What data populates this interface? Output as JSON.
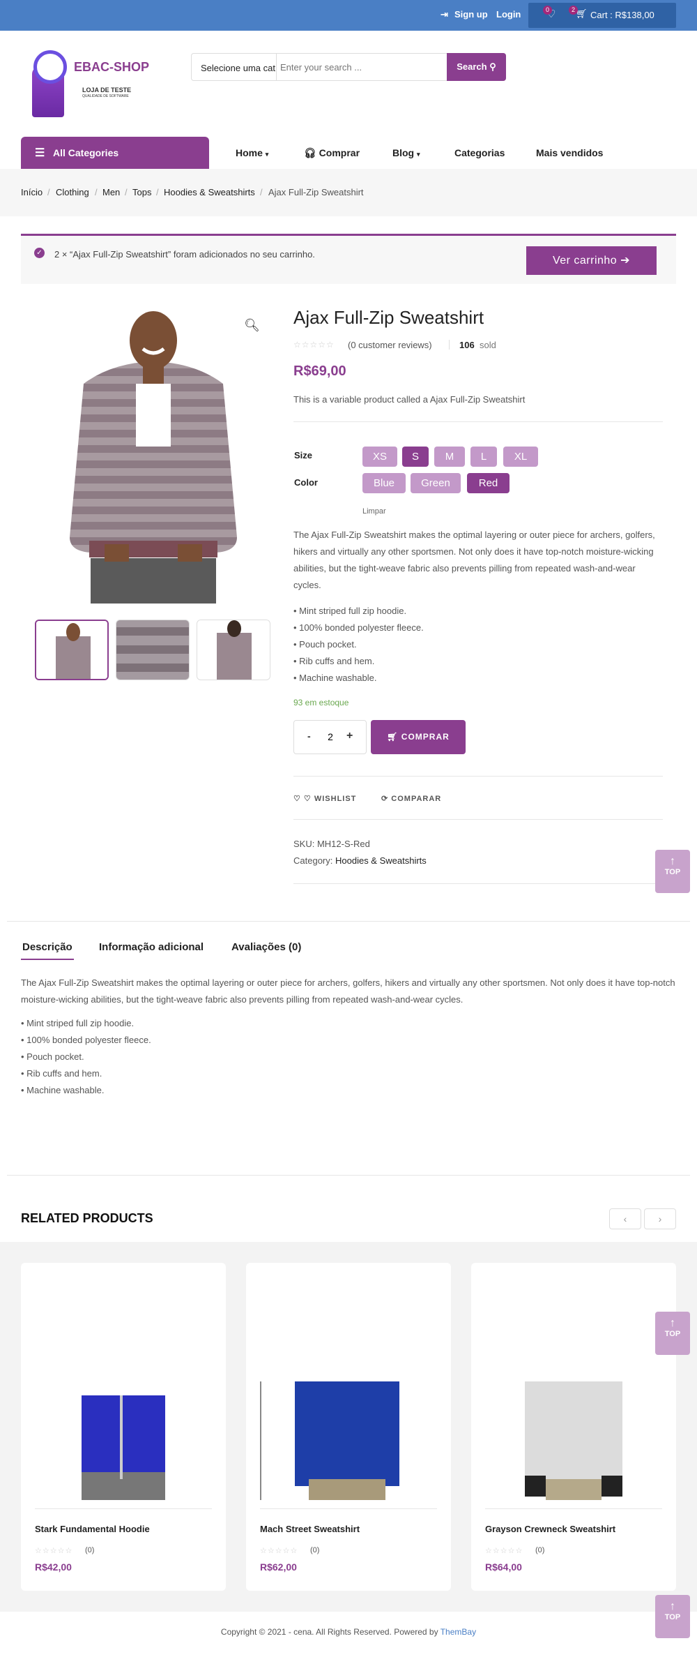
{
  "topbar": {
    "signup": "Sign up",
    "login": "Login",
    "wishlist_count": "0",
    "cart_count": "2",
    "cart_label": "Cart : R$138,00"
  },
  "brand": {
    "name": "EBAC-SHOP",
    "tagline1": "LOJA DE TESTE",
    "tagline2": "QUALIDADE DE SOFTWARE"
  },
  "search": {
    "category": "Selecione uma cat",
    "placeholder": "Enter your search ...",
    "button": "Search"
  },
  "nav": {
    "all_categories": "All Categories",
    "items": [
      "Home",
      "Comprar",
      "Blog",
      "Categorias",
      "Mais vendidos"
    ]
  },
  "breadcrumb": [
    "Início",
    "Clothing",
    "Men",
    "Tops",
    "Hoodies & Sweatshirts",
    "Ajax Full-Zip Sweatshirt"
  ],
  "notice": {
    "text": "2 × “Ajax Full-Zip Sweatshirt” foram adicionados no seu carrinho.",
    "button": "Ver carrinho"
  },
  "product": {
    "title": "Ajax Full-Zip Sweatshirt",
    "reviews": "(0 customer reviews)",
    "sold_count": "106",
    "sold_label": "sold",
    "price": "R$69,00",
    "short_desc": "This is a variable product called a Ajax Full-Zip Sweatshirt",
    "size_label": "Size",
    "sizes": [
      "XS",
      "S",
      "M",
      "L",
      "XL"
    ],
    "color_label": "Color",
    "colors": [
      "Blue",
      "Green",
      "Red"
    ],
    "clear": "Limpar",
    "description": "The Ajax Full-Zip Sweatshirt makes the optimal layering or outer piece for archers, golfers, hikers and virtually any other sportsmen. Not only does it have top-notch moisture-wicking abilities, but the tight-weave fabric also prevents pilling from repeated wash-and-wear cycles.",
    "features": [
      "• Mint striped full zip hoodie.",
      "• 100% bonded polyester fleece.",
      "• Pouch pocket.",
      "• Rib cuffs and hem.",
      "• Machine washable."
    ],
    "stock": "93 em estoque",
    "qty": "2",
    "qty_minus": "-",
    "qty_plus": "+",
    "add_button": "COMPRAR",
    "wishlist": "WISHLIST",
    "compare": "COMPARAR",
    "sku": "SKU: MH12-S-Red",
    "category_label": "Category:",
    "category": "Hoodies & Sweatshirts"
  },
  "tabs": [
    "Descrição",
    "Informação adicional",
    "Avaliações (0)"
  ],
  "tab_content": {
    "description": "The Ajax Full-Zip Sweatshirt makes the optimal layering or outer piece for archers, golfers, hikers and virtually any other sportsmen. Not only does it have top-notch moisture-wicking abilities, but the tight-weave fabric also prevents pilling from repeated wash-and-wear cycles.",
    "features": [
      "• Mint striped full zip hoodie.",
      "• 100% bonded polyester fleece.",
      "• Pouch pocket.",
      "• Rib cuffs and hem.",
      "• Machine washable."
    ]
  },
  "related": {
    "title": "RELATED PRODUCTS",
    "items": [
      {
        "name": "Stark Fundamental Hoodie",
        "reviews": "(0)",
        "price": "R$42,00"
      },
      {
        "name": "Mach Street Sweatshirt",
        "reviews": "(0)",
        "price": "R$62,00"
      },
      {
        "name": "Grayson Crewneck Sweatshirt",
        "reviews": "(0)",
        "price": "R$64,00"
      }
    ]
  },
  "top_label": "TOP",
  "footer": {
    "text": "Copyright © 2021 - cena. All Rights Reserved. Powered by",
    "link": "ThemBay"
  },
  "colors": {
    "accent": "#8a3e8f",
    "topbar": "#4a7fc5",
    "swatch": "#c399c9"
  }
}
